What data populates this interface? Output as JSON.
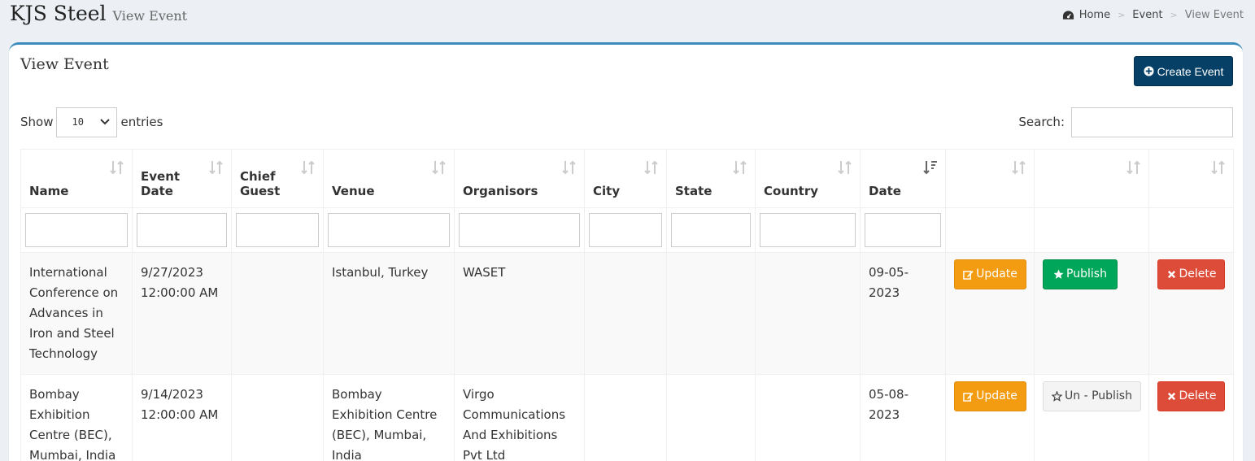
{
  "header": {
    "brand": "KJS Steel",
    "subtitle": "View Event",
    "breadcrumb": [
      "Home",
      "Event",
      "View Event"
    ]
  },
  "box": {
    "title": "View Event",
    "create_label": "Create Event"
  },
  "controls": {
    "show_label": "Show",
    "entries_value": "10",
    "entries_label": "entries",
    "search_label": "Search:"
  },
  "table": {
    "columns": [
      {
        "label": "Name"
      },
      {
        "label": "Event Date"
      },
      {
        "label": "Chief Guest"
      },
      {
        "label": "Venue"
      },
      {
        "label": "Organisors"
      },
      {
        "label": "City"
      },
      {
        "label": "State"
      },
      {
        "label": "Country"
      },
      {
        "label": "Date"
      },
      {
        "label": ""
      },
      {
        "label": ""
      },
      {
        "label": ""
      }
    ],
    "rows": [
      {
        "name": "International Conference on Advances in Iron and Steel Technology",
        "event_date": "9/27/2023 12:00:00 AM",
        "chief_guest": "",
        "venue": "Istanbul, Turkey",
        "organisors": "WASET",
        "city": "",
        "state": "",
        "country": "",
        "date": "09-05-2023",
        "update_label": "Update",
        "publish_label": "Publish",
        "delete_label": "Delete"
      },
      {
        "name": "Bombay Exhibition Centre (BEC), Mumbai, India",
        "event_date": "9/14/2023 12:00:00 AM",
        "chief_guest": "",
        "venue": "Bombay Exhibition Centre (BEC), Mumbai, India",
        "organisors": "Virgo Communications And Exhibitions Pvt Ltd",
        "city": "",
        "state": "",
        "country": "",
        "date": "05-08-2023",
        "update_label": "Update",
        "publish_label": "Un - Publish",
        "delete_label": "Delete"
      }
    ]
  },
  "colors": {
    "accent": "#3c8dbc",
    "create": "#064066",
    "update": "#f39c12",
    "publish": "#00a65a",
    "delete": "#dd4b39"
  }
}
